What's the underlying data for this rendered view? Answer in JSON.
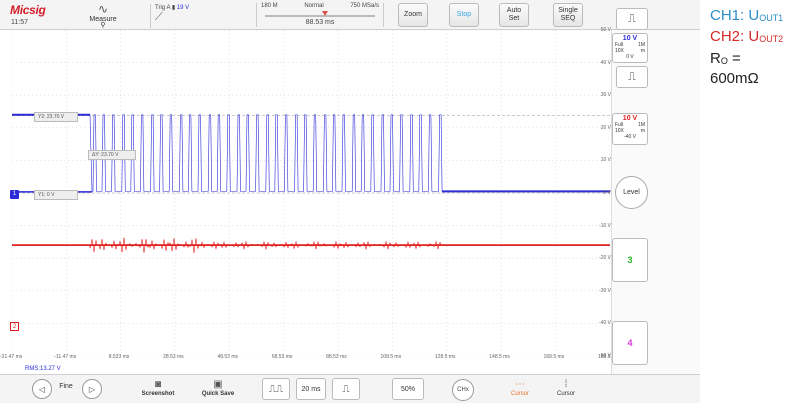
{
  "app": {
    "logo": "Micsig",
    "clock": "11:57",
    "measure_label": "Measure",
    "trigger": {
      "text": "Trig",
      "channel": "A",
      "level": "19 V"
    },
    "timebase": {
      "timebase": "180 M",
      "mode": "Normal",
      "sample_rate": "750 MSa/s",
      "delay": "88.53 ms"
    },
    "buttons": {
      "zoom": "Zoom",
      "stop": "Stop",
      "auto_set": "Auto\nSet",
      "single_seq": "Single\nSEQ"
    }
  },
  "plot": {
    "y_ticks": [
      "50 V",
      "40 V",
      "30 V",
      "20 V",
      "10 V",
      "0 V",
      "-10 V",
      "-20 V",
      "-30 V",
      "-40 V",
      "-50 V"
    ],
    "x_ticks": [
      "-31.47 ms",
      "-11.47 ms",
      "8.533 ms",
      "28.53 ms",
      "48.53 ms",
      "68.53 ms",
      "88.53 ms",
      "108.5 ms",
      "128.5 ms",
      "148.5 ms",
      "168.5 ms",
      "188.5 ms"
    ],
    "cursor_labels": {
      "y2": "Y2: 23.70 V",
      "dy": "ΔY: 23.70 V",
      "y1": "Y1: 0 V"
    },
    "marker_ch1": "1",
    "marker_ch2": "2",
    "colors": {
      "ch1": "#2b2bd8",
      "ch2": "#e02020"
    }
  },
  "right_panel": {
    "ch1": {
      "scale": "10 V",
      "bw": "Full",
      "probe": "10X",
      "impedance": "1M",
      "unit": "m",
      "offset": "0 V"
    },
    "ch2": {
      "scale": "10 V",
      "bw": "Full",
      "probe": "10X",
      "impedance": "1M",
      "unit": "m",
      "offset": "-40 V"
    },
    "level_label": "Level",
    "ch3_label": "3",
    "ch4_label": "4"
  },
  "status": {
    "rms": "RMS:13.27 V"
  },
  "bottom": {
    "fine_label": "Fine",
    "screenshot_label": "Screenshot",
    "quick_save_label": "Quick Save",
    "time_value": "20 ms",
    "percent": "50%",
    "chx_label": "CHx",
    "cursor_label": "Cursor",
    "cursor2_label": "Cursor"
  },
  "annotation": {
    "ch1_text": "CH1: U",
    "ch1_sub": "OUT1",
    "ch2_text": "CH2: U",
    "ch2_sub": "OUT2",
    "ro_text": "R",
    "ro_sub": "O",
    "ro_eq": " =",
    "ro_value": "600mΩ",
    "colors": {
      "ch1": "#2a8ec8",
      "ch2": "#d42a28"
    }
  }
}
